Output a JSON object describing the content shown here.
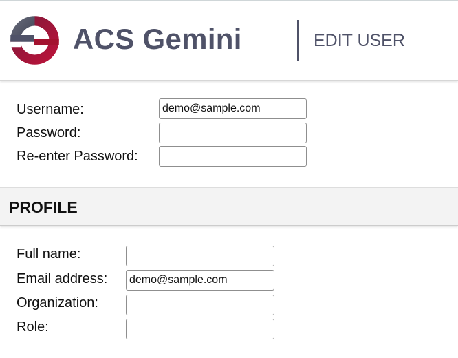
{
  "header": {
    "app_title": "ACS Gemini",
    "page_heading": "EDIT USER",
    "logo_colors": {
      "gray": "#4f5268",
      "red": "#a3122f"
    }
  },
  "account": {
    "username_label": "Username:",
    "username_value": "demo@sample.com",
    "password_label": "Password:",
    "password_value": "",
    "reenter_password_label": "Re-enter Password:",
    "reenter_password_value": ""
  },
  "profile": {
    "section_title": "PROFILE",
    "full_name_label": "Full name:",
    "full_name_value": "",
    "email_label": "Email address:",
    "email_value": "demo@sample.com",
    "organization_label": "Organization:",
    "organization_value": "",
    "role_label": "Role:",
    "role_value": ""
  }
}
